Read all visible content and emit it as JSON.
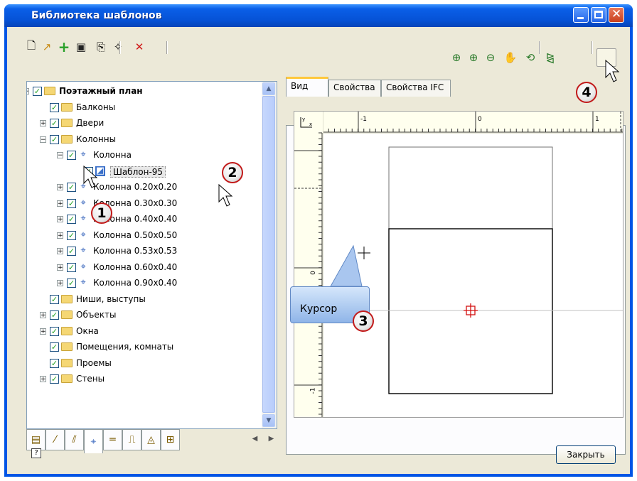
{
  "window": {
    "title": "Библиотека шаблонов"
  },
  "toolbar_left": [
    {
      "name": "new-file-icon",
      "glyph": "🗋"
    },
    {
      "name": "open-icon",
      "glyph": "↗"
    },
    {
      "name": "add-icon",
      "glyph": "+"
    },
    {
      "name": "save-icon",
      "glyph": "▣"
    },
    {
      "name": "new-template-icon",
      "glyph": "⎘"
    },
    {
      "name": "copy-template-icon",
      "glyph": "✧"
    },
    {
      "name": "delete-icon",
      "glyph": "✕"
    }
  ],
  "toolbar_right": [
    {
      "name": "zoom-extents-icon",
      "glyph": "⊕"
    },
    {
      "name": "zoom-in-icon",
      "glyph": "⊕"
    },
    {
      "name": "zoom-out-icon",
      "glyph": "⊖"
    },
    {
      "name": "pan-icon",
      "glyph": "✋"
    },
    {
      "name": "rotate-icon",
      "glyph": "⟲"
    },
    {
      "name": "mirror-icon",
      "glyph": "⧎"
    },
    {
      "name": "insertion-point-icon",
      "glyph": "⌖"
    }
  ],
  "tree": {
    "root": "Поэтажный план",
    "items": [
      {
        "label": "Балконы",
        "type": "folder",
        "level": 1,
        "expander": ""
      },
      {
        "label": "Двери",
        "type": "folder",
        "level": 1,
        "expander": "+"
      },
      {
        "label": "Колонны",
        "type": "folder",
        "level": 1,
        "expander": "−"
      },
      {
        "label": "Колонна",
        "type": "column",
        "level": 2,
        "expander": "−"
      },
      {
        "label": "Шаблон-95",
        "type": "template",
        "level": 3,
        "expander": "",
        "selected": true
      },
      {
        "label": "Колонна 0.20x0.20",
        "type": "column",
        "level": 2,
        "expander": "+"
      },
      {
        "label": "Колонна 0.30x0.30",
        "type": "column",
        "level": 2,
        "expander": "+"
      },
      {
        "label": "Колонна 0.40x0.40",
        "type": "column",
        "level": 2,
        "expander": "+"
      },
      {
        "label": "Колонна 0.50x0.50",
        "type": "column",
        "level": 2,
        "expander": "+"
      },
      {
        "label": "Колонна 0.53x0.53",
        "type": "column",
        "level": 2,
        "expander": "+"
      },
      {
        "label": "Колонна 0.60x0.40",
        "type": "column",
        "level": 2,
        "expander": "+"
      },
      {
        "label": "Колонна 0.90x0.40",
        "type": "column",
        "level": 2,
        "expander": "+"
      },
      {
        "label": "Ниши, выступы",
        "type": "folder",
        "level": 1,
        "expander": ""
      },
      {
        "label": "Объекты",
        "type": "folder",
        "level": 1,
        "expander": "+"
      },
      {
        "label": "Окна",
        "type": "folder",
        "level": 1,
        "expander": "+"
      },
      {
        "label": "Помещения, комнаты",
        "type": "folder",
        "level": 1,
        "expander": ""
      },
      {
        "label": "Проемы",
        "type": "folder",
        "level": 1,
        "expander": ""
      },
      {
        "label": "Стены",
        "type": "folder",
        "level": 1,
        "expander": "+"
      }
    ]
  },
  "bottom_tabs": [
    {
      "name": "tab-documents-icon",
      "glyph": "▤"
    },
    {
      "name": "tab-walls-icon",
      "glyph": "⁄"
    },
    {
      "name": "tab-slabs-icon",
      "glyph": "⫽"
    },
    {
      "name": "tab-columns-icon",
      "glyph": "⌖",
      "selected": true
    },
    {
      "name": "tab-beams-icon",
      "glyph": "═"
    },
    {
      "name": "tab-doors-icon",
      "glyph": "⎍"
    },
    {
      "name": "tab-objects-icon",
      "glyph": "◬"
    },
    {
      "name": "tab-windows-icon",
      "glyph": "⊞"
    }
  ],
  "right_tabs": {
    "view": "Вид",
    "props": "Свойства",
    "ifc": "Свойства IFC"
  },
  "ruler": {
    "h1": "-1",
    "h2": "0",
    "h3": "1",
    "v1": "0",
    "v2": "-1"
  },
  "annotations": {
    "n1": "1",
    "n2": "2",
    "n3": "3",
    "n4": "4",
    "cursor_label": "Курсор"
  },
  "buttons": {
    "close": "Закрыть",
    "help": "?"
  },
  "colors": {
    "title_blue": "#0055e5",
    "accent_red": "#c21a1a",
    "check_green": "#21a121"
  }
}
